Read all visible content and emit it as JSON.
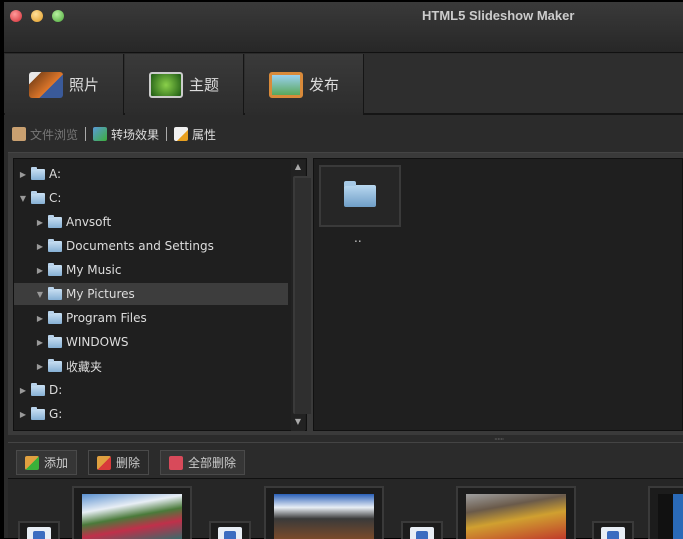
{
  "window": {
    "title": "HTML5 Slideshow Maker"
  },
  "tabs": [
    {
      "label": "照片",
      "icon": "photos-icon"
    },
    {
      "label": "主题",
      "icon": "theme-icon"
    },
    {
      "label": "发布",
      "icon": "publish-icon"
    }
  ],
  "toolbar": {
    "file_browse": "文件浏览",
    "transition": "转场效果",
    "properties": "属性"
  },
  "tree": [
    {
      "label": "A:",
      "expanded": false
    },
    {
      "label": "C:",
      "expanded": true
    },
    {
      "label": "Anvsoft",
      "expanded": false
    },
    {
      "label": "Documents and Settings",
      "expanded": false
    },
    {
      "label": "My Music",
      "expanded": false
    },
    {
      "label": "My Pictures",
      "expanded": true,
      "selected": true
    },
    {
      "label": "Program Files",
      "expanded": false
    },
    {
      "label": "WINDOWS",
      "expanded": false
    },
    {
      "label": "收藏夹",
      "expanded": false
    },
    {
      "label": "D:",
      "expanded": false
    },
    {
      "label": "G:",
      "expanded": false
    }
  ],
  "files": [
    {
      "label": ".."
    }
  ],
  "buttons": {
    "add": "添加",
    "delete": "删除",
    "delete_all": "全部删除"
  },
  "colors": {
    "close": "#e0444a",
    "minimize": "#e8a634",
    "maximize": "#5cb84a"
  }
}
